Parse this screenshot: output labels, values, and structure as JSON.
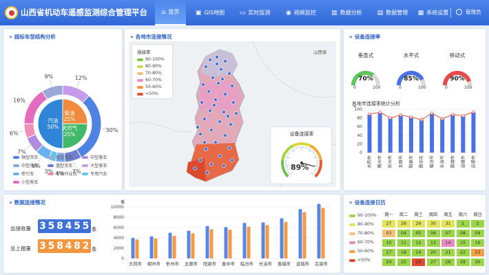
{
  "header": {
    "title": "山西省机动车遥感监测综合管理平台",
    "nav": [
      {
        "label": "首页",
        "icon": "home-icon",
        "glyph": "⌂"
      },
      {
        "label": "GIS地图",
        "icon": "map-icon",
        "glyph": "▣"
      },
      {
        "label": "实时监测",
        "icon": "monitor-icon",
        "glyph": "▭"
      },
      {
        "label": "视频监控",
        "icon": "camera-icon",
        "glyph": "◉"
      },
      {
        "label": "数据分析",
        "icon": "chart-icon",
        "glyph": "▥"
      },
      {
        "label": "数据管理",
        "icon": "database-icon",
        "glyph": "▤"
      },
      {
        "label": "系统设置",
        "icon": "settings-icon",
        "glyph": "▦"
      }
    ],
    "user": "管理员"
  },
  "panels": {
    "vehicle": "超标车型结构分析",
    "map": "各地市连接情况",
    "rate": "设备连接率",
    "data": "数据连接情况",
    "calendar": "设备连接日历"
  },
  "donut": {
    "outer_labels": [
      "9%",
      "12%",
      "30%",
      "7%",
      "4%",
      "3%",
      "6%",
      "7%",
      "6%",
      "16%"
    ],
    "inner": [
      {
        "label": "汽油",
        "pct": "50%",
        "color": "#2f86d8"
      },
      {
        "label": "柴油",
        "pct": "25%",
        "color": "#f08a3c"
      },
      {
        "label": "天然气",
        "pct": "25%",
        "color": "#43b86b"
      }
    ],
    "legend": [
      {
        "label": "微型货车",
        "color": "#4e83e3"
      },
      {
        "label": "轻型货车",
        "color": "#9aa7d8"
      },
      {
        "label": "中型客车",
        "color": "#b08be0"
      },
      {
        "label": "中型货车",
        "color": "#7fa6ee"
      },
      {
        "label": "重型货车",
        "color": "#6e7fcf"
      },
      {
        "label": "大型客车",
        "color": "#c49be8"
      },
      {
        "label": "牵引车",
        "color": "#69b2f0"
      },
      {
        "label": "专项作业车",
        "color": "#ef8fb8"
      },
      {
        "label": "专用汽车",
        "color": "#5fc6e8"
      },
      {
        "label": "小型客车",
        "color": "#e46cc0"
      }
    ]
  },
  "map": {
    "legend_title": "连接率",
    "legend": [
      {
        "label": "90-100%",
        "color": "#7ec83f"
      },
      {
        "label": "80-90%",
        "color": "#c9d94a"
      },
      {
        "label": "70-80%",
        "color": "#f0c07a"
      },
      {
        "label": "60-70%",
        "color": "#e58fc0"
      },
      {
        "label": "50-60%",
        "color": "#f0943e"
      },
      {
        "label": "<50%",
        "color": "#e05533"
      }
    ],
    "region_label": "山西省",
    "gauge_title": "设备连接率",
    "gauge_value": "89%",
    "gauge_pct": 89
  },
  "gauges": [
    {
      "label": "垂直式",
      "value": "70%",
      "pct": 70,
      "color": "#5cc65a",
      "min": "0",
      "max": "100"
    },
    {
      "label": "水平式",
      "value": "85%",
      "pct": 85,
      "color": "#4a72e6",
      "min": "0",
      "max": "100"
    },
    {
      "label": "移动式",
      "value": "90%",
      "pct": 90,
      "color": "#e84a4a",
      "min": "0",
      "max": "100"
    }
  ],
  "city_chart_title": "各地市连接率统计分析",
  "chart_data": [
    {
      "type": "bar",
      "title": "各地市连接率统计分析",
      "ylabel": "%",
      "ylim": [
        0,
        100
      ],
      "yticks": [
        "100",
        "80",
        "60",
        "40",
        "20",
        "0"
      ],
      "categories": [
        "大同市",
        "朔州市",
        "忻州市",
        "太原市",
        "阳泉市",
        "晋中市",
        "临汾市",
        "长治市",
        "晋城市",
        "运城市",
        "吕梁市"
      ],
      "values": [
        88,
        92,
        80,
        86,
        82,
        76,
        90,
        78,
        88,
        84,
        93
      ],
      "line": [
        89,
        93,
        80,
        87,
        82,
        76,
        91,
        78,
        88,
        85,
        94
      ]
    },
    {
      "type": "bar",
      "ylabel": "条",
      "ylim": [
        0,
        10000
      ],
      "yticks": [
        "10000",
        "8000",
        "6000",
        "4000",
        "2000",
        "0"
      ],
      "categories": [
        "大同市",
        "朔州市",
        "忻州市",
        "太原市",
        "阳泉市",
        "晋中市",
        "临汾市",
        "长治市",
        "晋城市",
        "运城市",
        "吕梁市"
      ],
      "series": [
        {
          "values": [
            4000,
            4300,
            5000,
            5400,
            6300,
            6100,
            6900,
            7000,
            7800,
            9600,
            10600
          ],
          "color": "#5b86e2"
        },
        {
          "values": [
            3700,
            3900,
            4400,
            4900,
            5700,
            5600,
            6200,
            6500,
            7100,
            9000,
            9800
          ],
          "color": "#f39a45"
        }
      ]
    }
  ],
  "totals": {
    "received_label": "总接收量",
    "received_digits": [
      "3",
      "5",
      "8",
      "4",
      "5",
      "5"
    ],
    "received_unit": "条",
    "reported_label": "总上报量",
    "reported_digits": [
      "3",
      "5",
      "8",
      "4",
      "8",
      "2"
    ],
    "reported_unit": "条"
  },
  "calendar": {
    "legend": [
      {
        "label": "90-100%",
        "color": "#9bd54a"
      },
      {
        "label": "80-90%",
        "color": "#e3e45a"
      },
      {
        "label": "70-80%",
        "color": "#f2c27b"
      },
      {
        "label": "60-70%",
        "color": "#e98bc3"
      },
      {
        "label": "50-60%",
        "color": "#f2a04a"
      },
      {
        "label": "<50%",
        "color": "#e34a2f"
      }
    ],
    "weekdays": [
      "周一",
      "周二",
      "周三",
      "周四",
      "周五",
      "周六",
      "周日"
    ],
    "rows": [
      [
        {
          "d": "27",
          "c": "#e3e45a"
        },
        {
          "d": "28",
          "c": "#e3e45a"
        },
        {
          "d": "29",
          "c": "#e3e45a"
        },
        {
          "d": "30",
          "c": "#e3e45a"
        },
        {
          "d": "31",
          "c": "#e3e45a"
        },
        {
          "d": "1",
          "c": "#9bd54a"
        },
        {
          "d": "2",
          "c": "#9bd54a"
        }
      ],
      [
        {
          "d": "03",
          "c": "#f2c27b"
        },
        {
          "d": "04",
          "c": "#9bd54a"
        },
        {
          "d": "05",
          "c": "#9bd54a"
        },
        {
          "d": "06",
          "c": "#9bd54a"
        },
        {
          "d": "07",
          "c": "#9bd54a"
        },
        {
          "d": "08",
          "c": "#9bd54a"
        },
        {
          "d": "09",
          "c": "#9bd54a"
        }
      ],
      [
        {
          "d": "10",
          "c": "#9bd54a"
        },
        {
          "d": "11",
          "c": "#9bd54a"
        },
        {
          "d": "12",
          "c": "#9bd54a"
        },
        {
          "d": "13",
          "c": "#9bd54a"
        },
        {
          "d": "14",
          "c": "#e98bc3"
        },
        {
          "d": "15",
          "c": "#9bd54a"
        },
        {
          "d": "16",
          "c": "#9bd54a"
        }
      ],
      [
        {
          "d": "17",
          "c": "#9bd54a"
        },
        {
          "d": "18",
          "c": "#9bd54a"
        },
        {
          "d": "19",
          "c": "#9bd54a"
        },
        {
          "d": "20",
          "c": "#9bd54a"
        },
        {
          "d": "21",
          "c": "#9bd54a"
        },
        {
          "d": "22",
          "c": "#9bd54a"
        },
        {
          "d": "23",
          "c": "#f2a04a"
        }
      ],
      [
        {
          "d": "24",
          "c": "#9bd54a"
        },
        {
          "d": "25",
          "c": "#9bd54a"
        },
        {
          "d": "26",
          "c": "#e34a2f"
        },
        {
          "d": "27",
          "c": "#9bd54a"
        },
        {
          "d": "28",
          "c": "#9bd54a"
        },
        {
          "d": "29",
          "c": "#9bd54a"
        },
        {
          "d": "30",
          "c": "#9bd54a"
        }
      ]
    ]
  }
}
